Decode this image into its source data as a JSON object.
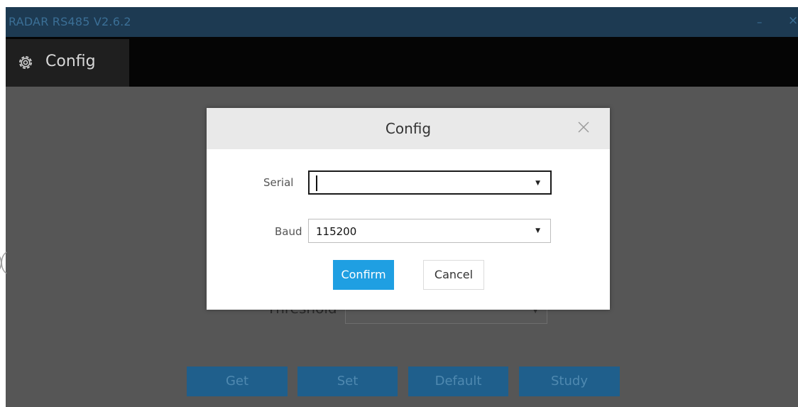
{
  "window": {
    "title": "RADAR RS485 V2.6.2",
    "minimize_glyph": "–",
    "close_glyph": "×",
    "colors": {
      "titlebar": "#1d3a52",
      "tabbar": "#050505",
      "content": "#565656",
      "accent": "#1f9fe2"
    }
  },
  "tabbar": {
    "tabs": [
      {
        "label": "Config",
        "icon": "gear-icon",
        "active": true
      }
    ]
  },
  "background_form": {
    "threshold_label": "Threshold",
    "buttons": {
      "get": "Get",
      "set": "Set",
      "default": "Default",
      "study": "Study"
    }
  },
  "dialog": {
    "title": "Config",
    "close_icon": "close-icon",
    "serial": {
      "label": "Serial",
      "value": ""
    },
    "baud": {
      "label": "Baud",
      "value": "115200"
    },
    "confirm_label": "Confirm",
    "cancel_label": "Cancel"
  }
}
